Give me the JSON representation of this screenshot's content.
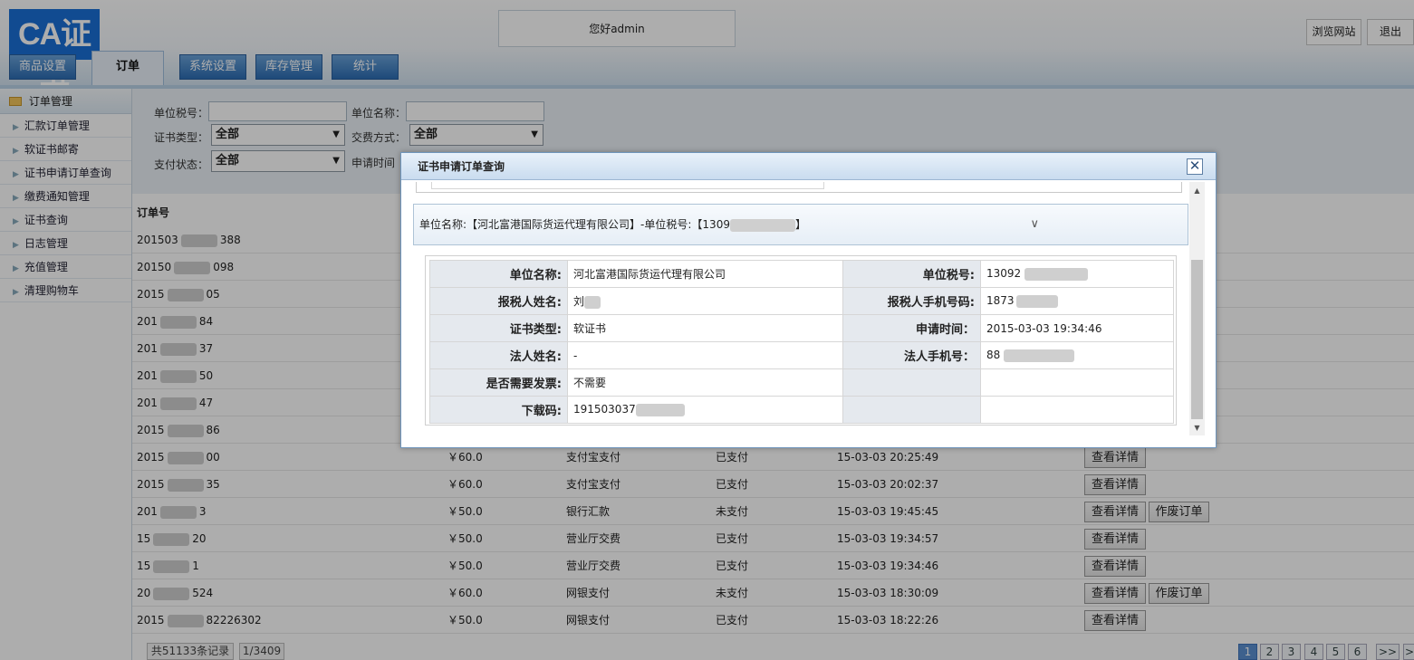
{
  "header": {
    "logo_text": "CA证书",
    "greeting": "您好admin",
    "browse_site": "浏览网站",
    "logout": "退出",
    "tabs": [
      {
        "label": "商品设置",
        "active": false
      },
      {
        "label": "订单",
        "active": true
      },
      {
        "label": "系统设置",
        "active": false
      },
      {
        "label": "库存管理",
        "active": false
      },
      {
        "label": "统计",
        "active": false
      }
    ]
  },
  "sidebar": {
    "title": "订单管理",
    "items": [
      {
        "label": "汇款订单管理"
      },
      {
        "label": "软证书邮寄"
      },
      {
        "label": "证书申请订单查询"
      },
      {
        "label": "缴费通知管理"
      },
      {
        "label": "证书查询"
      },
      {
        "label": "日志管理"
      },
      {
        "label": "充值管理"
      },
      {
        "label": "清理购物车"
      }
    ]
  },
  "filter": {
    "tax_no_label": "单位税号：",
    "unit_name_label": "单位名称：",
    "cert_type_label": "证书类型：",
    "cert_type_value": "全部",
    "pay_method_label": "交费方式：",
    "pay_method_value": "全部",
    "pay_status_label": "支付状态：",
    "pay_status_value": "全部",
    "apply_time_label": "申请时间"
  },
  "table": {
    "col_order_no": "订单号",
    "rows": [
      {
        "order_a": "201503",
        "order_b": "388",
        "amount": "",
        "method": "",
        "status": "",
        "time": "",
        "actions": []
      },
      {
        "order_a": "20150",
        "order_b": "098",
        "amount": "",
        "method": "",
        "status": "",
        "time": "",
        "actions": []
      },
      {
        "order_a": "2015",
        "order_b": "05",
        "amount": "",
        "method": "",
        "status": "",
        "time": "",
        "actions": []
      },
      {
        "order_a": "201",
        "order_b": "84",
        "amount": "",
        "method": "",
        "status": "",
        "time": "",
        "actions": []
      },
      {
        "order_a": "201",
        "order_b": "37",
        "amount": "",
        "method": "",
        "status": "",
        "time": "",
        "actions": []
      },
      {
        "order_a": "201",
        "order_b": "50",
        "amount": "",
        "method": "",
        "status": "",
        "time": "",
        "actions": []
      },
      {
        "order_a": "201",
        "order_b": "47",
        "amount": "",
        "method": "",
        "status": "",
        "time": "",
        "actions": []
      },
      {
        "order_a": "2015",
        "order_b": "86",
        "amount": "",
        "method": "",
        "status": "",
        "time": "",
        "actions": []
      },
      {
        "order_a": "2015",
        "order_b": "00",
        "amount": "￥60.0",
        "method": "支付宝支付",
        "status": "已支付",
        "time": "15-03-03 20:25:49",
        "actions": [
          "查看详情"
        ]
      },
      {
        "order_a": "2015",
        "order_b": "35",
        "amount": "￥60.0",
        "method": "支付宝支付",
        "status": "已支付",
        "time": "15-03-03 20:02:37",
        "actions": [
          "查看详情"
        ]
      },
      {
        "order_a": "201",
        "order_b": "3",
        "amount": "￥50.0",
        "method": "银行汇款",
        "status": "未支付",
        "time": "15-03-03 19:45:45",
        "actions": [
          "查看详情",
          "作废订单"
        ]
      },
      {
        "order_a": "15",
        "order_b": "20",
        "amount": "￥50.0",
        "method": "营业厅交费",
        "status": "已支付",
        "time": "15-03-03 19:34:57",
        "actions": [
          "查看详情"
        ]
      },
      {
        "order_a": "15",
        "order_b": "1",
        "amount": "￥50.0",
        "method": "营业厅交费",
        "status": "已支付",
        "time": "15-03-03 19:34:46",
        "actions": [
          "查看详情"
        ]
      },
      {
        "order_a": "20",
        "order_b": "524",
        "amount": "￥60.0",
        "method": "网银支付",
        "status": "未支付",
        "time": "15-03-03 18:30:09",
        "actions": [
          "查看详情",
          "作废订单"
        ]
      },
      {
        "order_a": "2015",
        "order_b": "82226302",
        "amount": "￥50.0",
        "method": "网银支付",
        "status": "已支付",
        "time": "15-03-03 18:22:26",
        "actions": [
          "查看详情"
        ]
      }
    ]
  },
  "pagination": {
    "total_records": "共51133条记录",
    "page_info": "1/3409",
    "pages": [
      "1",
      "2",
      "3",
      "4",
      "5",
      "6",
      ">>",
      ">"
    ],
    "current": "1"
  },
  "dialog": {
    "title": "证书申请订单查询",
    "close_icon": "close-icon",
    "accordion_text": "单位名称:【河北富港国际货运代理有限公司】-单位税号:【1309",
    "accordion_tail": "】",
    "details": {
      "unit_name_label": "单位名称:",
      "unit_name": "河北富港国际货运代理有限公司",
      "tax_no_label": "单位税号:",
      "tax_no": "13092",
      "taxpayer_name_label": "报税人姓名:",
      "taxpayer_name": "刘",
      "taxpayer_phone_label": "报税人手机号码:",
      "taxpayer_phone": "1873",
      "cert_type_label": "证书类型:",
      "cert_type": "软证书",
      "apply_time_label": "申请时间：",
      "apply_time": "2015-03-03 19:34:46",
      "legal_name_label": "法人姓名:",
      "legal_name": "-",
      "legal_phone_label": "法人手机号：",
      "legal_phone": "88",
      "invoice_label": "是否需要发票:",
      "invoice": "不需要",
      "download_code_label": "下载码:",
      "download_code": "191503037"
    }
  }
}
